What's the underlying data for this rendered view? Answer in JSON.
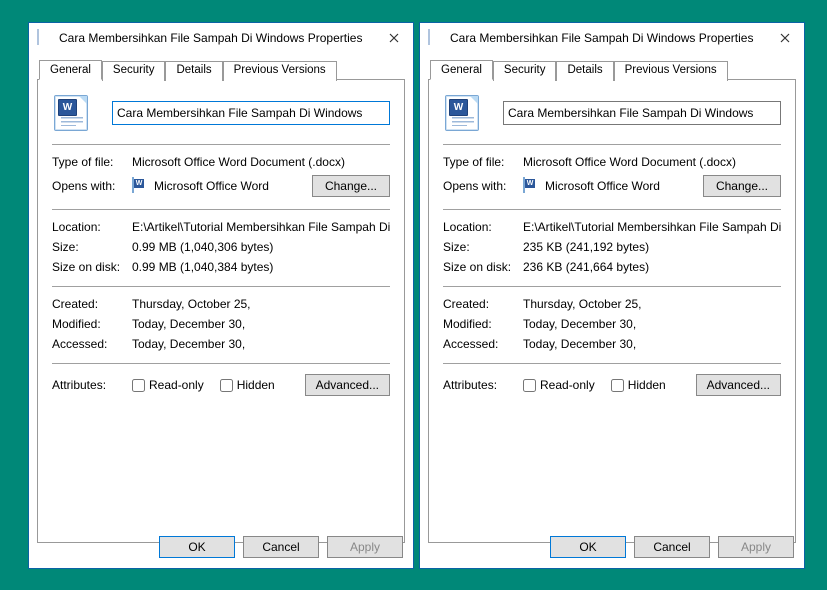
{
  "dialogs": [
    {
      "title": "Cara Membersihkan File Sampah Di Windows Properties",
      "tabs": {
        "general": "General",
        "security": "Security",
        "details": "Details",
        "previous": "Previous Versions"
      },
      "filename": "Cara Membersihkan File Sampah Di Windows",
      "type_label": "Type of file:",
      "type_value": "Microsoft Office Word Document (.docx)",
      "opens_label": "Opens with:",
      "opens_app": "Microsoft Office Word",
      "change_btn": "Change...",
      "location_label": "Location:",
      "location_value": "E:\\Artikel\\Tutorial Membersihkan File Sampah Di Wi",
      "size_label": "Size:",
      "size_value": "0.99 MB (1,040,306 bytes)",
      "sizeondisk_label": "Size on disk:",
      "sizeondisk_value": "0.99 MB (1,040,384 bytes)",
      "created_label": "Created:",
      "created_value": "Thursday, October 25,",
      "modified_label": "Modified:",
      "modified_value": "Today, December 30,",
      "accessed_label": "Accessed:",
      "accessed_value": "Today, December 30,",
      "attributes_label": "Attributes:",
      "readonly_label": "Read-only",
      "hidden_label": "Hidden",
      "advanced_btn": "Advanced...",
      "ok": "OK",
      "cancel": "Cancel",
      "apply": "Apply"
    },
    {
      "title": "Cara Membersihkan File Sampah Di Windows Properties",
      "tabs": {
        "general": "General",
        "security": "Security",
        "details": "Details",
        "previous": "Previous Versions"
      },
      "filename": "Cara Membersihkan File Sampah Di Windows",
      "type_label": "Type of file:",
      "type_value": "Microsoft Office Word Document (.docx)",
      "opens_label": "Opens with:",
      "opens_app": "Microsoft Office Word",
      "change_btn": "Change...",
      "location_label": "Location:",
      "location_value": "E:\\Artikel\\Tutorial Membersihkan File Sampah Di Wi",
      "size_label": "Size:",
      "size_value": "235 KB (241,192 bytes)",
      "sizeondisk_label": "Size on disk:",
      "sizeondisk_value": "236 KB (241,664 bytes)",
      "created_label": "Created:",
      "created_value": "Thursday, October 25,",
      "modified_label": "Modified:",
      "modified_value": "Today, December 30,",
      "accessed_label": "Accessed:",
      "accessed_value": "Today, December 30,",
      "attributes_label": "Attributes:",
      "readonly_label": "Read-only",
      "hidden_label": "Hidden",
      "advanced_btn": "Advanced...",
      "ok": "OK",
      "cancel": "Cancel",
      "apply": "Apply"
    }
  ]
}
